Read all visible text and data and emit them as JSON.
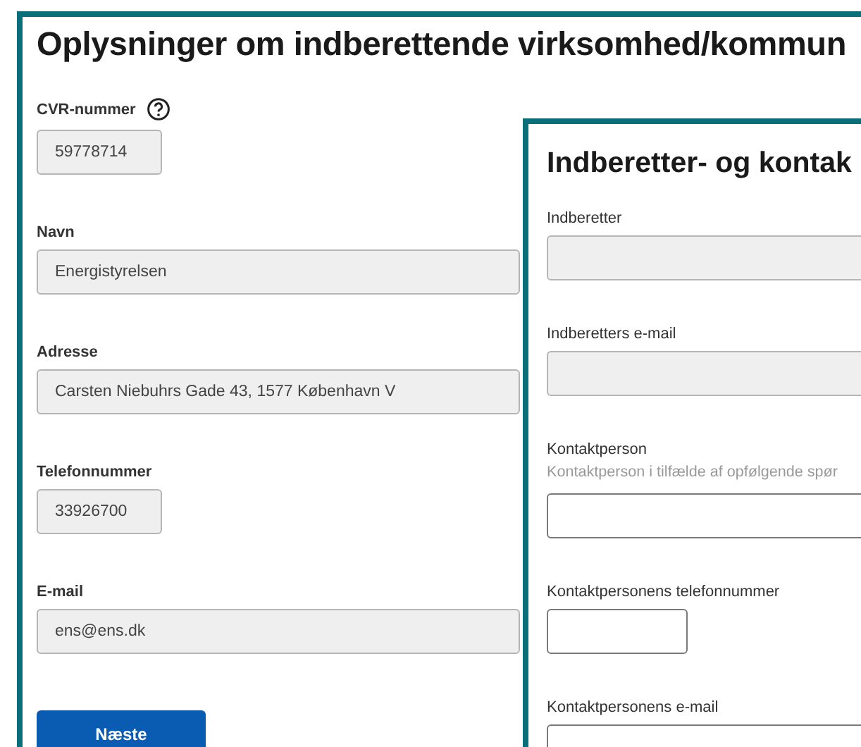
{
  "company_panel": {
    "title": "Oplysninger om indberettende virksomhed/kommun",
    "fields": [
      {
        "label": "CVR-nummer",
        "help": true,
        "value": "59778714",
        "disabled": true,
        "kind": "short"
      },
      {
        "label": "Navn",
        "help": false,
        "value": "Energistyrelsen",
        "disabled": true,
        "kind": "long"
      },
      {
        "label": "Adresse",
        "help": false,
        "value": "Carsten Niebuhrs Gade 43, 1577 København V",
        "disabled": true,
        "kind": "long"
      },
      {
        "label": "Telefonnummer",
        "help": false,
        "value": "33926700",
        "disabled": true,
        "kind": "short"
      },
      {
        "label": "E-mail",
        "help": false,
        "value": "ens@ens.dk",
        "disabled": true,
        "kind": "long"
      }
    ],
    "button": "Næste"
  },
  "contact_panel": {
    "title": "Indberetter- og kontak",
    "fields": [
      {
        "label": "Indberetter",
        "disabled": true,
        "kind": "long"
      },
      {
        "label": "Indberetters e-mail",
        "disabled": true,
        "kind": "long"
      },
      {
        "label": "Kontaktperson",
        "hint": "Kontaktperson i tilfælde af opfølgende spør",
        "disabled": false,
        "kind": "long"
      },
      {
        "label": "Kontaktpersonens telefonnummer",
        "disabled": false,
        "kind": "short"
      },
      {
        "label": "Kontaktpersonens e-mail",
        "disabled": false,
        "kind": "long"
      }
    ]
  }
}
